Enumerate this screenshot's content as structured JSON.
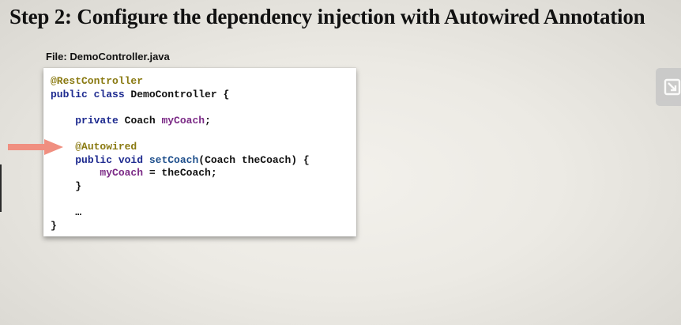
{
  "slide": {
    "title": "Step 2: Configure the dependency injection with Autowired Annotation",
    "file_label": "File: DemoController.java"
  },
  "code": {
    "lines": [
      [
        {
          "t": "@RestController",
          "c": "annotation"
        }
      ],
      [
        {
          "t": "public class ",
          "c": "kw"
        },
        {
          "t": "DemoController {",
          "c": "plain"
        }
      ],
      [],
      [
        {
          "t": "    "
        },
        {
          "t": "private ",
          "c": "kw"
        },
        {
          "t": "Coach ",
          "c": "plain"
        },
        {
          "t": "myCoach",
          "c": "field"
        },
        {
          "t": ";",
          "c": "plain"
        }
      ],
      [],
      [
        {
          "t": "    "
        },
        {
          "t": "@Autowired",
          "c": "annotation"
        }
      ],
      [
        {
          "t": "    "
        },
        {
          "t": "public void ",
          "c": "kw"
        },
        {
          "t": "setCoach",
          "c": "method"
        },
        {
          "t": "(Coach theCoach) {",
          "c": "plain"
        }
      ],
      [
        {
          "t": "        "
        },
        {
          "t": "myCoach",
          "c": "field"
        },
        {
          "t": " = theCoach;",
          "c": "plain"
        }
      ],
      [
        {
          "t": "    }",
          "c": "plain"
        }
      ],
      [],
      [
        {
          "t": "    …",
          "c": "plain"
        }
      ],
      [
        {
          "t": "}",
          "c": "plain"
        }
      ]
    ]
  },
  "colors": {
    "annotation": "#8a7a12",
    "keyword": "#1d2a8f",
    "field": "#7b2a86",
    "method": "#1e4f8c",
    "arrow": "#f08f80"
  },
  "icons": {
    "pointer": "right-arrow-icon",
    "collapse": "collapse-arrow-icon"
  }
}
